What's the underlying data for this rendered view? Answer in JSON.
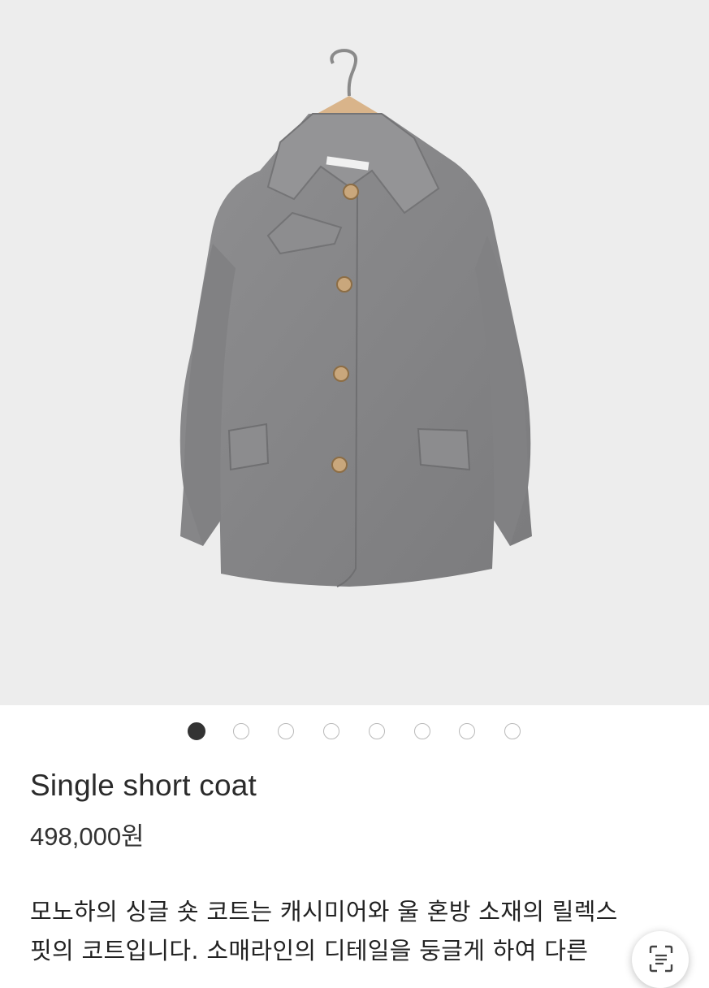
{
  "product": {
    "title": "Single short coat",
    "price": "498,000원",
    "image_alt": "grey wool coat on hanger"
  },
  "carousel": {
    "total": 8,
    "active_index": 0
  },
  "description": {
    "lines": [
      "모노하의 싱글 숏 코트는 캐시미어와 울 혼방 소재의 릴렉스",
      "핏의 코트입니다. 소매라인의 디테일을 둥글게 하여 다른"
    ]
  },
  "floating_button": {
    "icon": "scan-icon"
  },
  "colors": {
    "background": "#ededed",
    "coat": "#8a8a8c",
    "active_dot": "#333333"
  }
}
